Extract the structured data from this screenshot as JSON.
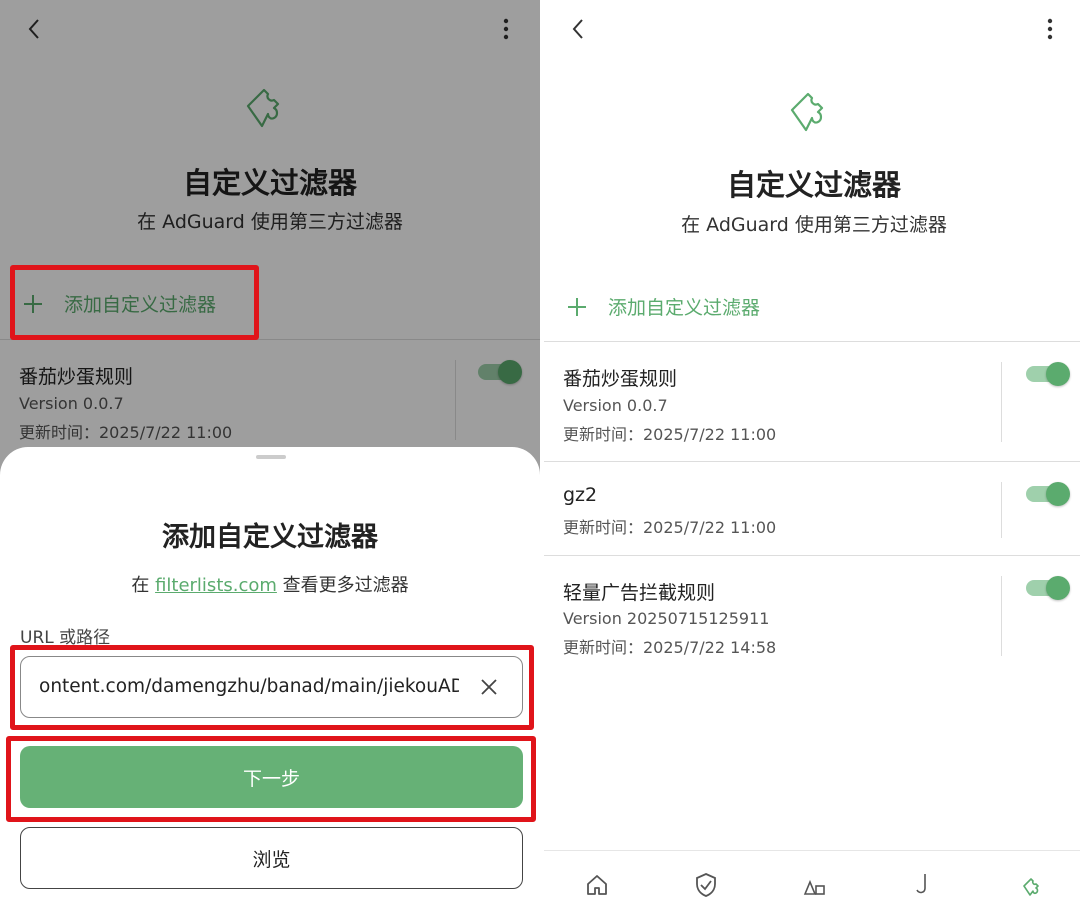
{
  "left": {
    "title": "自定义过滤器",
    "subtitle": "在 AdGuard 使用第三方过滤器",
    "add_label": "添加自定义过滤器",
    "filter": {
      "name": "番茄炒蛋规则",
      "version": "Version 0.0.7",
      "updated": "更新时间：2025/7/22 11:00",
      "enabled": true
    },
    "sheet": {
      "title": "添加自定义过滤器",
      "hint_prefix": "在 ",
      "hint_link": "filterlists.com",
      "hint_suffix": " 查看更多过滤器",
      "field_label": "URL 或路径",
      "url_value": "ontent.com/damengzhu/banad/main/jiekouAD.txt",
      "next_label": "下一步",
      "browse_label": "浏览"
    }
  },
  "right": {
    "title": "自定义过滤器",
    "subtitle": "在 AdGuard 使用第三方过滤器",
    "add_label": "添加自定义过滤器",
    "filters": [
      {
        "name": "番茄炒蛋规则",
        "version": "Version 0.0.7",
        "updated": "更新时间：2025/7/22 11:00",
        "enabled": true
      },
      {
        "name": "gz2",
        "updated": "更新时间：2025/7/22 11:00",
        "enabled": true
      },
      {
        "name": "轻量广告拦截规则",
        "version": "Version 20250715125911",
        "updated": "更新时间：2025/7/22 14:58",
        "enabled": true
      }
    ],
    "nav_icons": [
      "home-icon",
      "shield-icon",
      "activity-icon",
      "hook-icon",
      "puzzle-icon"
    ]
  },
  "colors": {
    "accent": "#5bab6e",
    "button_green": "#66b176",
    "highlight_red": "#e0141a",
    "overlay": "rgba(0,0,0,0.38)"
  }
}
